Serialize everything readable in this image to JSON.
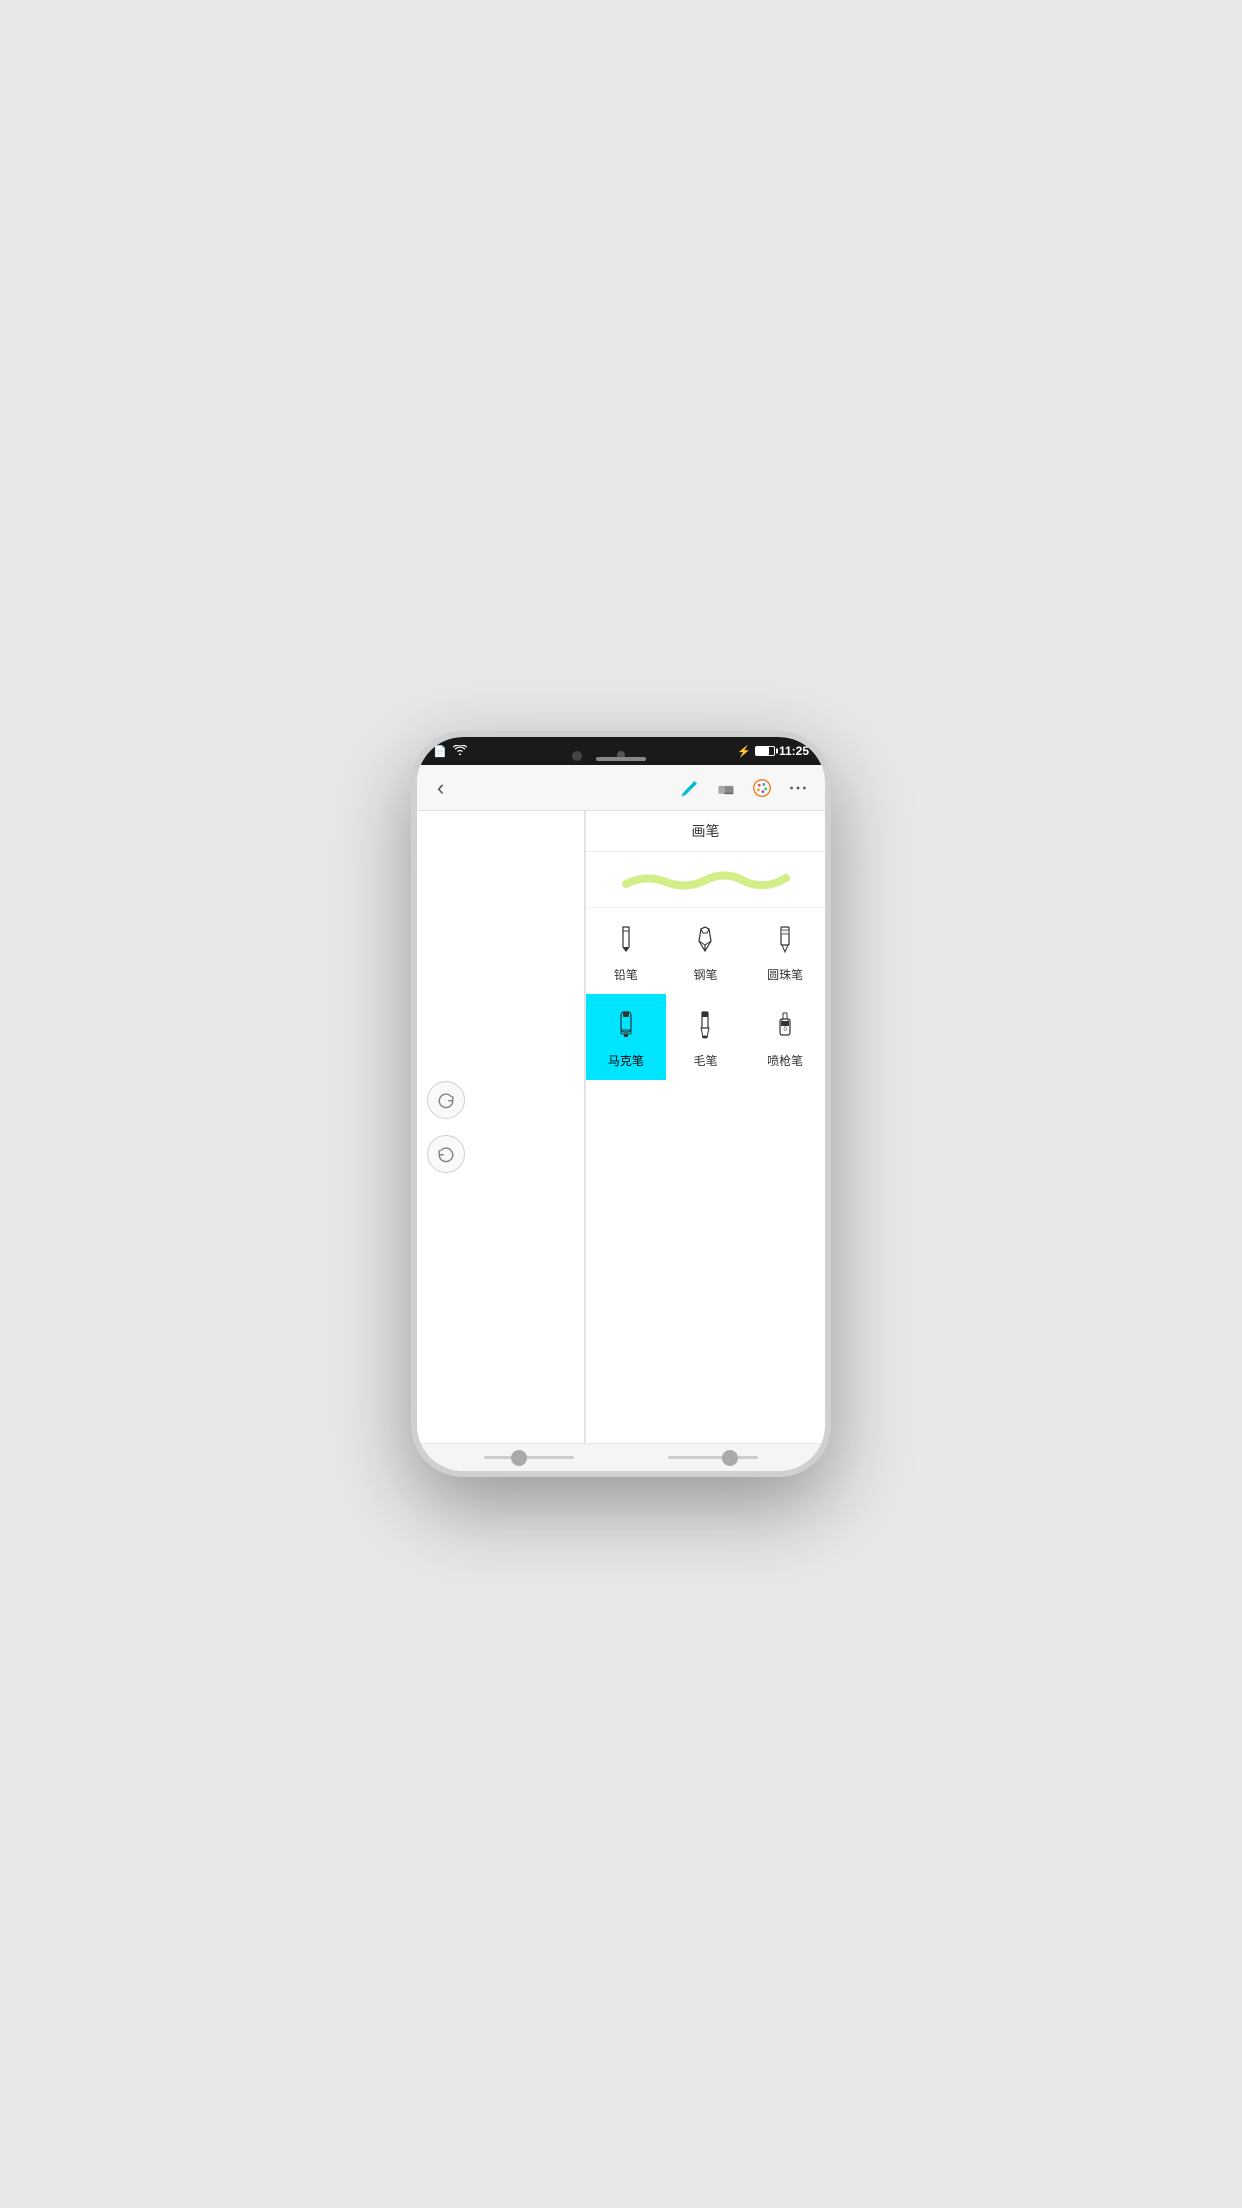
{
  "status_bar": {
    "time": "11:25",
    "battery_icon": "🔋",
    "bluetooth": "bluetooth"
  },
  "toolbar": {
    "back_label": "‹",
    "title": "",
    "more_label": "···"
  },
  "panel": {
    "title": "画笔",
    "brush_types": [
      {
        "id": "pencil",
        "label": "铅笔",
        "active": false
      },
      {
        "id": "pen",
        "label": "钢笔",
        "active": false
      },
      {
        "id": "ballpoint",
        "label": "圆珠笔",
        "active": false
      },
      {
        "id": "marker",
        "label": "马克笔",
        "active": true
      },
      {
        "id": "brush",
        "label": "毛笔",
        "active": false
      },
      {
        "id": "spray",
        "label": "喷枪笔",
        "active": false
      }
    ]
  },
  "bottom_sliders": {
    "slider1_position": "30%",
    "slider2_position": "60%"
  },
  "undo_label": "↺",
  "redo_label": "↻"
}
